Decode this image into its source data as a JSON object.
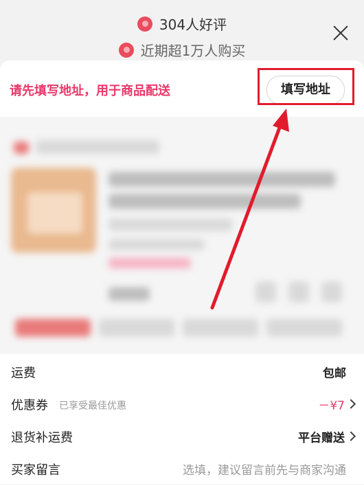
{
  "badges": {
    "good_reviews": "304人好评",
    "recent_buyers": "近期超1万人购买"
  },
  "address_banner": {
    "prompt": "请先填写地址，用于商品配送",
    "button_label": "填写地址"
  },
  "order_rows": [
    {
      "label": "运费",
      "sub": "",
      "value": "包邮"
    },
    {
      "label": "优惠券",
      "sub": "已享受最佳优惠",
      "value": "－¥7"
    },
    {
      "label": "退货补运费",
      "sub": "",
      "value": "平台赠送"
    },
    {
      "label": "买家留言",
      "sub": "",
      "value": "选填，建议留言前先与商家沟通"
    }
  ],
  "colors": {
    "accent_pink": "#e8386a",
    "annotation_red": "#e21b2c"
  }
}
